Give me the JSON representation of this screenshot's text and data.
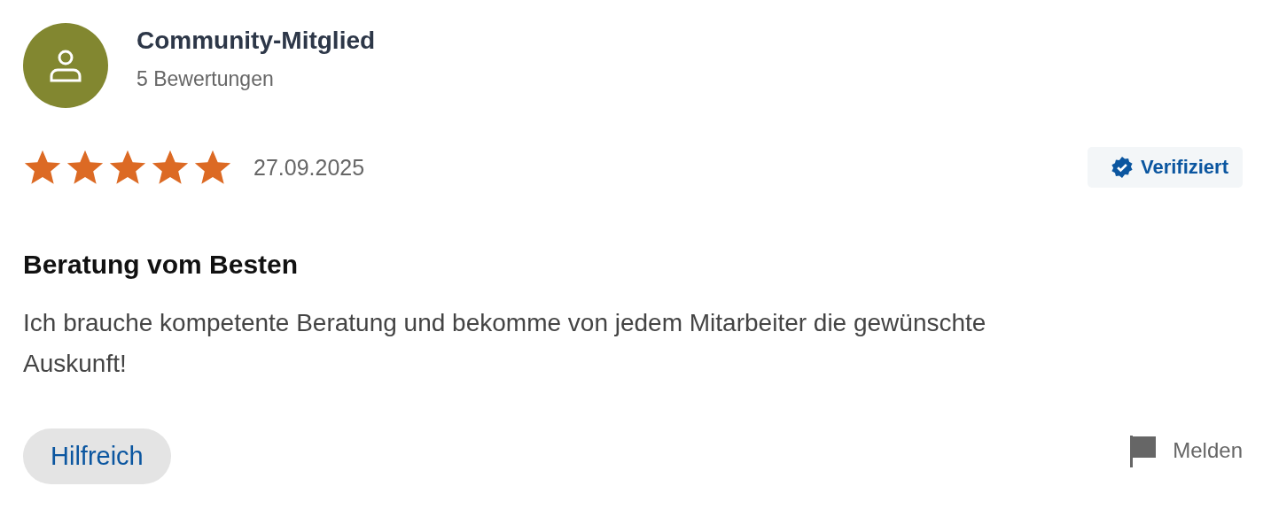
{
  "reviewer": {
    "name": "Community-Mitglied",
    "review_count": "5 Bewertungen"
  },
  "review": {
    "stars": 5,
    "date": "27.09.2025",
    "verified": true,
    "verified_label": "Verifiziert",
    "title": "Beratung vom Besten",
    "text": "Ich brauche kompetente Beratung und bekomme von jedem Mitarbeiter die gewünschte Auskunft!"
  },
  "actions": {
    "helpful": "Hilfreich",
    "report": "Melden"
  }
}
